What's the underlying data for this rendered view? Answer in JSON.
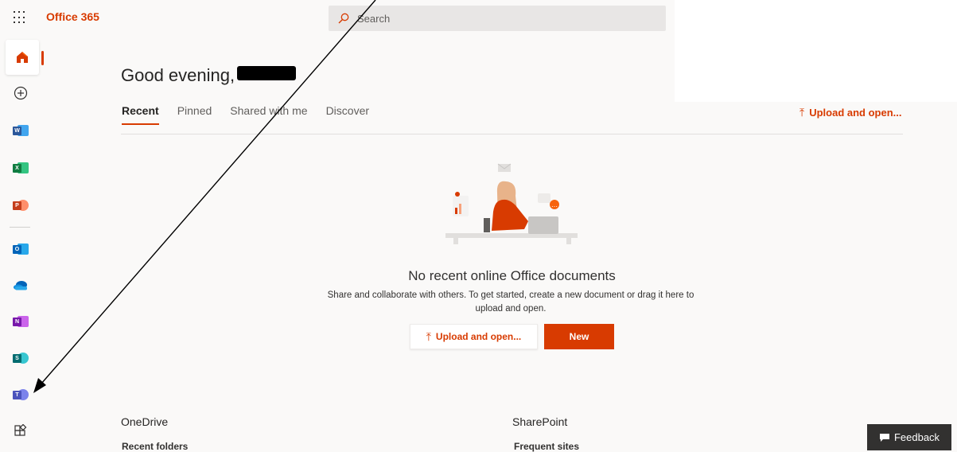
{
  "header": {
    "brand": "Office 365",
    "search_placeholder": "Search"
  },
  "rail": {
    "items": [
      {
        "name": "home",
        "label": ""
      },
      {
        "name": "create",
        "label": ""
      },
      {
        "name": "word",
        "letter": "W"
      },
      {
        "name": "excel",
        "letter": "X"
      },
      {
        "name": "powerpoint",
        "letter": "P"
      },
      {
        "name": "outlook",
        "letter": "O"
      },
      {
        "name": "onedrive",
        "letter": ""
      },
      {
        "name": "onenote",
        "letter": "N"
      },
      {
        "name": "sharepoint",
        "letter": "S"
      },
      {
        "name": "teams",
        "letter": "T"
      },
      {
        "name": "all-apps",
        "letter": ""
      }
    ]
  },
  "main": {
    "greeting": "Good evening,",
    "tabs": [
      "Recent",
      "Pinned",
      "Shared with me",
      "Discover"
    ],
    "upload_label": "Upload and open...",
    "empty_title": "No recent online Office documents",
    "empty_desc": "Share and collaborate with others. To get started, create a new document or drag it here to upload and open.",
    "new_label": "New",
    "onedrive_title": "OneDrive",
    "onedrive_sub": "Recent folders",
    "sharepoint_title": "SharePoint",
    "sharepoint_sub": "Frequent sites"
  },
  "feedback_label": "Feedback",
  "colors": {
    "accent": "#d83b01",
    "word": "#2b579a",
    "excel": "#217346",
    "powerpoint": "#d24726",
    "outlook": "#0078d4",
    "onedrive": "#0364b8",
    "onenote": "#7719aa",
    "sharepoint": "#038387",
    "teams": "#5059c9"
  }
}
